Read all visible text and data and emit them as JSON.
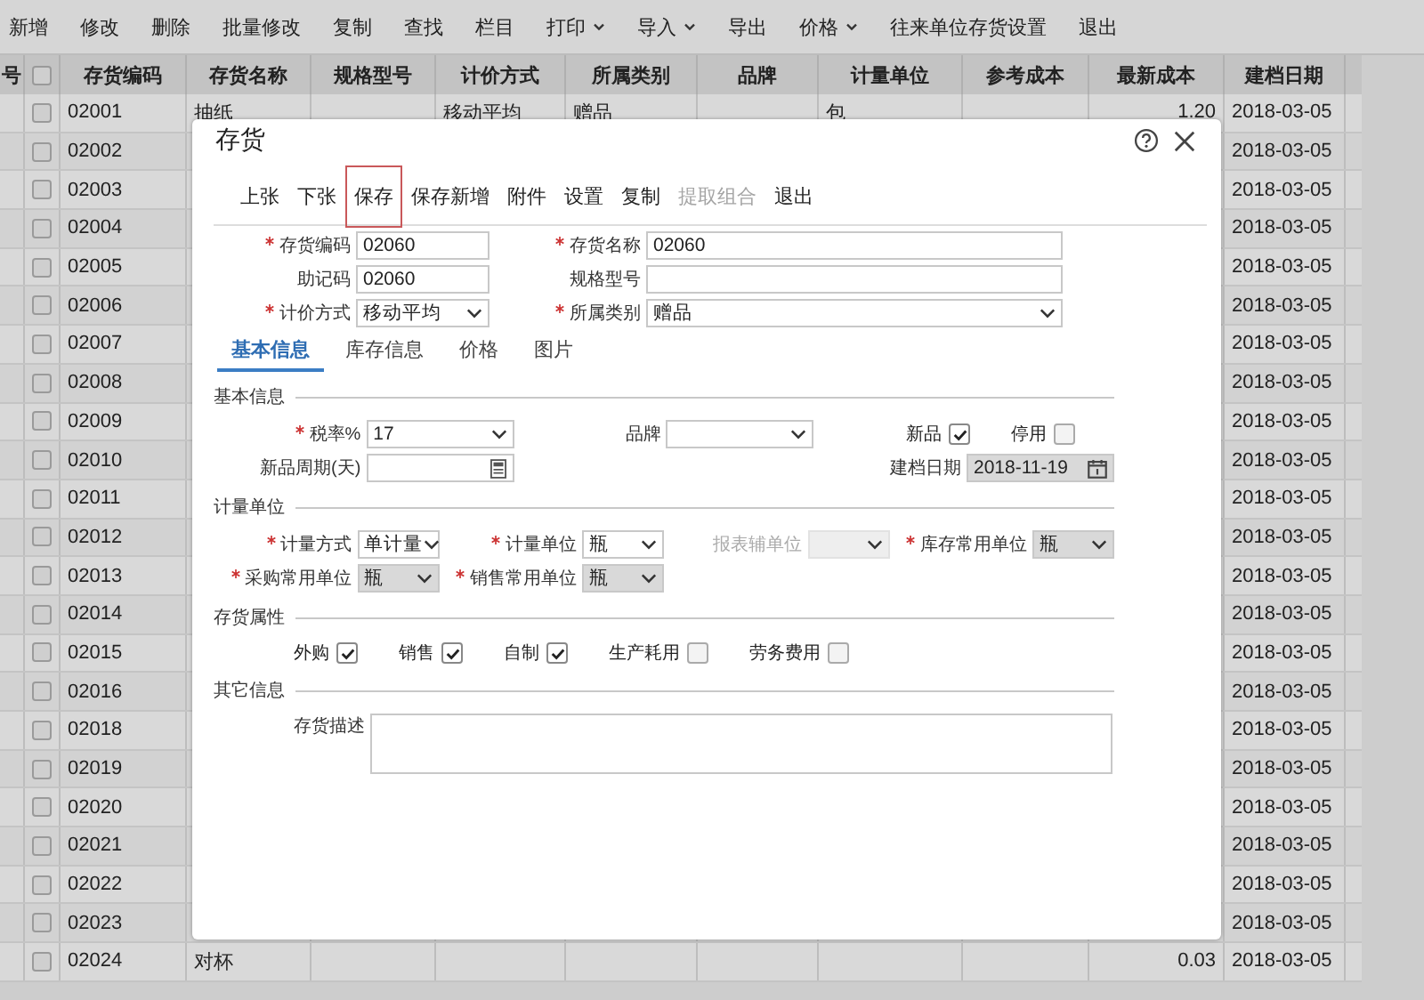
{
  "toolbar": [
    {
      "label": "新增",
      "dropdown": false
    },
    {
      "label": "修改",
      "dropdown": false
    },
    {
      "label": "删除",
      "dropdown": false
    },
    {
      "label": "批量修改",
      "dropdown": false
    },
    {
      "label": "复制",
      "dropdown": false
    },
    {
      "label": "查找",
      "dropdown": false
    },
    {
      "label": "栏目",
      "dropdown": false
    },
    {
      "label": "打印",
      "dropdown": true
    },
    {
      "label": "导入",
      "dropdown": true
    },
    {
      "label": "导出",
      "dropdown": false
    },
    {
      "label": "价格",
      "dropdown": true
    },
    {
      "label": "往来单位存货设置",
      "dropdown": false
    },
    {
      "label": "退出",
      "dropdown": false
    }
  ],
  "table": {
    "index_header": "号",
    "columns": [
      "存货编码",
      "存货名称",
      "规格型号",
      "计价方式",
      "所属类别",
      "品牌",
      "计量单位",
      "参考成本",
      "最新成本",
      "建档日期"
    ],
    "header_checked": false,
    "rows": [
      {
        "checked": false,
        "cells": [
          "02001",
          "抽纸",
          null,
          "移动平均",
          "赠品",
          null,
          "包",
          null,
          "1.20",
          "2018-03-05"
        ]
      },
      {
        "checked": false,
        "cells": [
          "02002",
          null,
          null,
          null,
          null,
          null,
          null,
          null,
          null,
          "2018-03-05"
        ]
      },
      {
        "checked": false,
        "cells": [
          "02003",
          null,
          null,
          null,
          null,
          null,
          null,
          null,
          null,
          "2018-03-05"
        ]
      },
      {
        "checked": false,
        "cells": [
          "02004",
          null,
          null,
          null,
          null,
          null,
          null,
          null,
          null,
          "2018-03-05"
        ]
      },
      {
        "checked": false,
        "cells": [
          "02005",
          null,
          null,
          null,
          null,
          null,
          null,
          null,
          null,
          "2018-03-05"
        ]
      },
      {
        "checked": false,
        "cells": [
          "02006",
          null,
          null,
          null,
          null,
          null,
          null,
          null,
          null,
          "2018-03-05"
        ]
      },
      {
        "checked": false,
        "cells": [
          "02007",
          null,
          null,
          null,
          null,
          null,
          null,
          null,
          null,
          "2018-03-05"
        ]
      },
      {
        "checked": false,
        "cells": [
          "02008",
          null,
          null,
          null,
          null,
          null,
          null,
          null,
          null,
          "2018-03-05"
        ]
      },
      {
        "checked": false,
        "cells": [
          "02009",
          null,
          null,
          null,
          null,
          null,
          null,
          null,
          null,
          "2018-03-05"
        ]
      },
      {
        "checked": false,
        "cells": [
          "02010",
          null,
          null,
          null,
          null,
          null,
          null,
          null,
          null,
          "2018-03-05"
        ]
      },
      {
        "checked": false,
        "cells": [
          "02011",
          null,
          null,
          null,
          null,
          null,
          null,
          null,
          null,
          "2018-03-05"
        ]
      },
      {
        "checked": false,
        "cells": [
          "02012",
          null,
          null,
          null,
          null,
          null,
          null,
          null,
          null,
          "2018-03-05"
        ]
      },
      {
        "checked": false,
        "cells": [
          "02013",
          null,
          null,
          null,
          null,
          null,
          null,
          null,
          null,
          "2018-03-05"
        ]
      },
      {
        "checked": false,
        "cells": [
          "02014",
          null,
          null,
          null,
          null,
          null,
          null,
          null,
          null,
          "2018-03-05"
        ]
      },
      {
        "checked": false,
        "cells": [
          "02015",
          null,
          null,
          null,
          null,
          null,
          null,
          null,
          null,
          "2018-03-05"
        ]
      },
      {
        "checked": false,
        "cells": [
          "02016",
          null,
          null,
          null,
          null,
          null,
          null,
          null,
          null,
          "2018-03-05"
        ]
      },
      {
        "checked": false,
        "cells": [
          "02018",
          null,
          null,
          null,
          null,
          null,
          null,
          null,
          null,
          "2018-03-05"
        ]
      },
      {
        "checked": false,
        "cells": [
          "02019",
          null,
          null,
          null,
          null,
          null,
          null,
          null,
          null,
          "2018-03-05"
        ]
      },
      {
        "checked": false,
        "cells": [
          "02020",
          null,
          null,
          null,
          null,
          null,
          null,
          null,
          null,
          "2018-03-05"
        ]
      },
      {
        "checked": false,
        "cells": [
          "02021",
          null,
          null,
          null,
          null,
          null,
          null,
          null,
          null,
          "2018-03-05"
        ]
      },
      {
        "checked": false,
        "cells": [
          "02022",
          null,
          null,
          null,
          null,
          null,
          null,
          null,
          null,
          "2018-03-05"
        ]
      },
      {
        "checked": false,
        "cells": [
          "02023",
          null,
          null,
          null,
          null,
          null,
          null,
          null,
          null,
          "2018-03-05"
        ]
      },
      {
        "checked": false,
        "cells": [
          "02024",
          "对杯",
          null,
          null,
          null,
          null,
          null,
          null,
          "0.03",
          "2018-03-05"
        ]
      }
    ]
  },
  "dialog": {
    "title": "存货",
    "actions": [
      {
        "label": "上张",
        "focused": false,
        "disabled": false
      },
      {
        "label": "下张",
        "focused": false,
        "disabled": false
      },
      {
        "label": "保存",
        "focused": true,
        "disabled": false
      },
      {
        "label": "保存新增",
        "focused": false,
        "disabled": false
      },
      {
        "label": "附件",
        "focused": false,
        "disabled": false
      },
      {
        "label": "设置",
        "focused": false,
        "disabled": false
      },
      {
        "label": "复制",
        "focused": false,
        "disabled": false
      },
      {
        "label": "提取组合",
        "focused": false,
        "disabled": true
      },
      {
        "label": "退出",
        "focused": false,
        "disabled": false
      }
    ],
    "fields": [
      {
        "label": "存货编码",
        "required": true,
        "kind": "text",
        "value": "02060"
      },
      {
        "label": "存货名称",
        "required": true,
        "kind": "text",
        "value": "02060"
      },
      {
        "label": "助记码",
        "required": false,
        "kind": "text",
        "value": "02060"
      },
      {
        "label": "规格型号",
        "required": false,
        "kind": "text"
      },
      {
        "label": "计价方式",
        "required": true,
        "kind": "select",
        "value": "移动平均"
      },
      {
        "label": "所属类别",
        "required": true,
        "kind": "select",
        "value": "赠品"
      }
    ],
    "tabs": [
      {
        "label": "基本信息",
        "selected": true
      },
      {
        "label": "库存信息",
        "selected": false
      },
      {
        "label": "价格",
        "selected": false
      },
      {
        "label": "图片",
        "selected": false
      }
    ],
    "sections": [
      {
        "title": "基本信息",
        "rows": [
          [
            {
              "kind": "select",
              "label": "税率%",
              "required": true,
              "value": "17",
              "disabled": false,
              "readonly": false
            },
            {
              "kind": "select",
              "label": "品牌",
              "required": false,
              "disabled": false,
              "readonly": false
            },
            {
              "kind": "checks",
              "items": [
                {
                  "label": "新品",
                  "checked": true
                },
                {
                  "label": "停用",
                  "checked": false
                }
              ]
            }
          ],
          [
            {
              "kind": "number",
              "label": "新品周期(天)",
              "required": false,
              "disabled": false,
              "readonly": false
            },
            null,
            {
              "kind": "date",
              "label": "建档日期",
              "required": false,
              "value": "2018-11-19",
              "disabled": false,
              "readonly": true
            }
          ]
        ]
      },
      {
        "title": "计量单位",
        "rows": [
          [
            {
              "kind": "select",
              "label": "计量方式",
              "required": true,
              "value": "单计量",
              "disabled": false,
              "readonly": false
            },
            {
              "kind": "select",
              "label": "计量单位",
              "required": true,
              "value": "瓶",
              "disabled": false,
              "readonly": false
            },
            {
              "kind": "select",
              "label": "报表辅单位",
              "required": false,
              "disabled": true,
              "readonly": false
            },
            {
              "kind": "select",
              "label": "库存常用单位",
              "required": true,
              "value": "瓶",
              "disabled": false,
              "readonly": true
            }
          ],
          [
            {
              "kind": "select",
              "label": "采购常用单位",
              "required": true,
              "value": "瓶",
              "disabled": false,
              "readonly": true
            },
            {
              "kind": "select",
              "label": "销售常用单位",
              "required": true,
              "value": "瓶",
              "disabled": false,
              "readonly": true
            },
            null,
            null
          ]
        ]
      },
      {
        "title": "存货属性",
        "rows": [
          [
            {
              "kind": "checks",
              "items": [
                {
                  "label": "外购",
                  "checked": true
                },
                {
                  "label": "销售",
                  "checked": true
                },
                {
                  "label": "自制",
                  "checked": true
                },
                {
                  "label": "生产耗用",
                  "checked": false
                },
                {
                  "label": "劳务费用",
                  "checked": false
                }
              ]
            }
          ]
        ]
      },
      {
        "title": "其它信息",
        "rows": [
          [
            {
              "kind": "textarea",
              "label": "存货描述",
              "required": false,
              "disabled": false,
              "readonly": false
            }
          ]
        ]
      }
    ]
  }
}
